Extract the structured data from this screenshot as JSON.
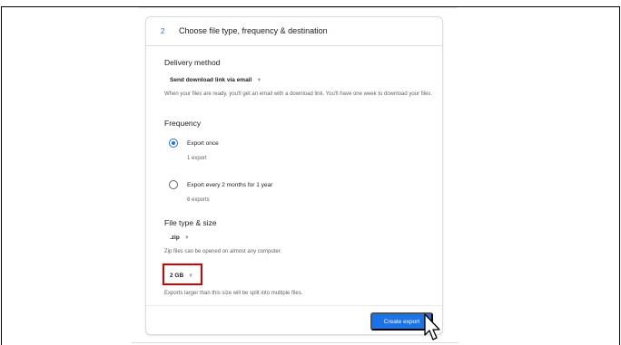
{
  "step": {
    "number": "2",
    "title": "Choose file type, frequency & destination"
  },
  "delivery": {
    "heading": "Delivery method",
    "selected": "Send download link via email",
    "help": "When your files are ready, you'll get an email with a download link. You'll have one week to download your files."
  },
  "frequency": {
    "heading": "Frequency",
    "options": [
      {
        "label": "Export once",
        "sub": "1 export",
        "checked": true
      },
      {
        "label": "Export every 2 months for 1 year",
        "sub": "6 exports",
        "checked": false
      }
    ]
  },
  "filetype": {
    "heading": "File type & size",
    "type_selected": ".zip",
    "type_help": "Zip files can be opened on almost any computer.",
    "size_selected": "2 GB",
    "size_help": "Exports larger than this size will be split into multiple files."
  },
  "actions": {
    "create_export": "Create export"
  },
  "icons": {
    "dropdown": "chevron-down-icon",
    "cursor": "mouse-pointer-icon"
  },
  "colors": {
    "accent": "#1a73e8",
    "highlight": "#d50000"
  }
}
